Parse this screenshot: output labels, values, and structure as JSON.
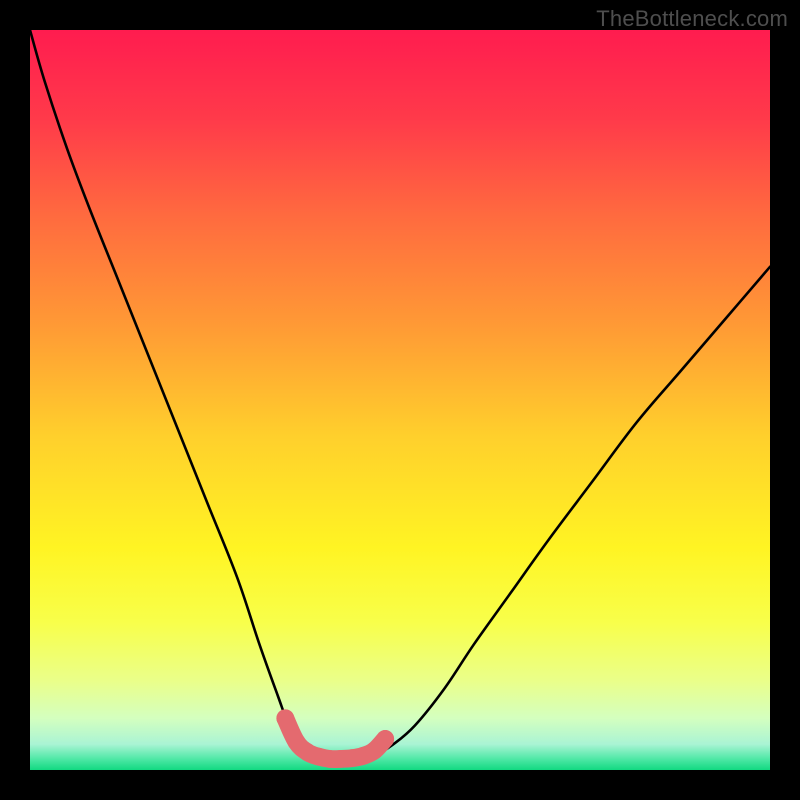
{
  "watermark": "TheBottleneck.com",
  "colors": {
    "background": "#000000",
    "curve": "#000000",
    "marker": "#e46a6f",
    "gradient_stops": [
      {
        "offset": 0.0,
        "hex": "#ff1c4f"
      },
      {
        "offset": 0.12,
        "hex": "#ff3a4a"
      },
      {
        "offset": 0.25,
        "hex": "#ff6a3f"
      },
      {
        "offset": 0.4,
        "hex": "#ff9a35"
      },
      {
        "offset": 0.55,
        "hex": "#ffd02c"
      },
      {
        "offset": 0.7,
        "hex": "#fff423"
      },
      {
        "offset": 0.8,
        "hex": "#f8ff4a"
      },
      {
        "offset": 0.88,
        "hex": "#eaff8a"
      },
      {
        "offset": 0.93,
        "hex": "#d4ffbf"
      },
      {
        "offset": 0.965,
        "hex": "#aaf4d4"
      },
      {
        "offset": 0.985,
        "hex": "#4fe8a6"
      },
      {
        "offset": 1.0,
        "hex": "#12d981"
      }
    ]
  },
  "chart_data": {
    "type": "line",
    "title": "",
    "xlabel": "",
    "ylabel": "",
    "xlim": [
      0,
      100
    ],
    "ylim": [
      0,
      100
    ],
    "grid": false,
    "legend": false,
    "series": [
      {
        "name": "bottleneck-curve",
        "x": [
          0,
          2,
          5,
          8,
          12,
          16,
          20,
          24,
          28,
          31,
          33.5,
          35,
          36.5,
          38,
          39.5,
          41,
          43,
          45,
          47,
          49,
          52,
          56,
          60,
          65,
          70,
          76,
          82,
          88,
          94,
          100
        ],
        "y": [
          100,
          93,
          84,
          76,
          66,
          56,
          46,
          36,
          26,
          17,
          10,
          6,
          3.5,
          2.2,
          1.6,
          1.4,
          1.4,
          1.6,
          2.2,
          3.4,
          6,
          11,
          17,
          24,
          31,
          39,
          47,
          54,
          61,
          68
        ]
      }
    ],
    "markers": {
      "name": "valley-markers",
      "x": [
        34.5,
        36,
        37.5,
        39,
        40.5,
        42,
        43.5,
        45,
        46.5,
        48
      ],
      "y": [
        7.0,
        3.8,
        2.4,
        1.8,
        1.5,
        1.5,
        1.6,
        1.9,
        2.6,
        4.2
      ],
      "radius": 1.2
    }
  }
}
